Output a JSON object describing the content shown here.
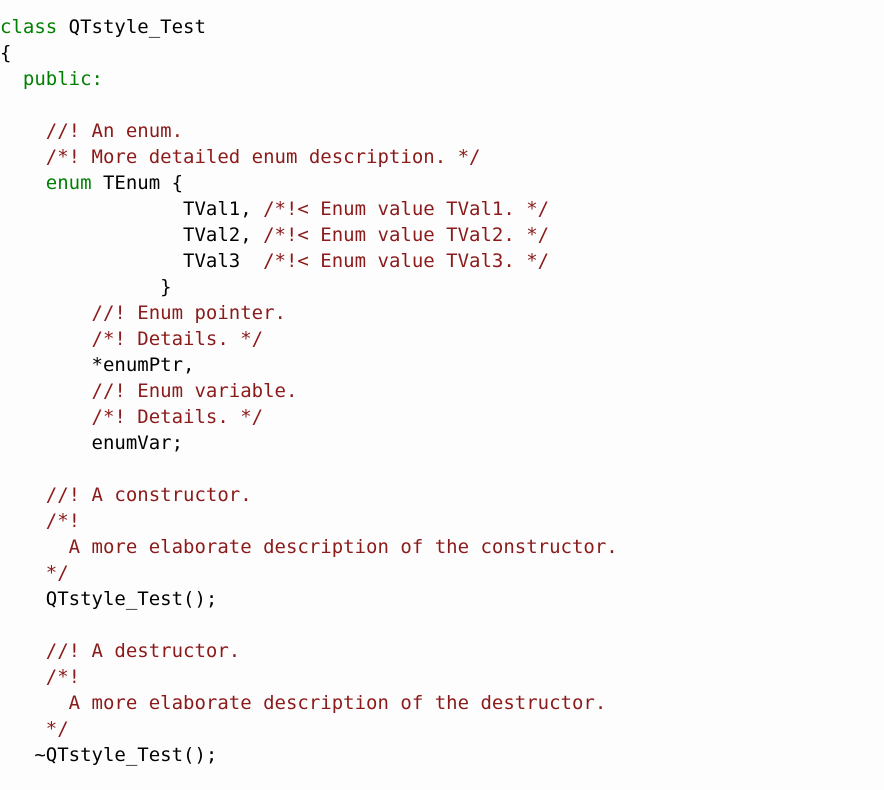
{
  "document": {
    "kind": "source-code-listing",
    "language": "C++",
    "class_name": "QTstyle_Test"
  },
  "colors": {
    "background": "#fdfdfd",
    "keyword": "#008000",
    "comment": "#8b1a1a",
    "identifier": "#000000"
  },
  "code": {
    "lines": [
      {
        "tokens": [
          {
            "t": "class ",
            "c": "kw"
          },
          {
            "t": "QTstyle_Test",
            "c": "plain"
          }
        ]
      },
      {
        "tokens": [
          {
            "t": "{",
            "c": "plain"
          }
        ]
      },
      {
        "tokens": [
          {
            "t": "  ",
            "c": "plain"
          },
          {
            "t": "public:",
            "c": "kw"
          }
        ]
      },
      {
        "tokens": []
      },
      {
        "tokens": [
          {
            "t": "    ",
            "c": "plain"
          },
          {
            "t": "//! An enum.",
            "c": "comment"
          }
        ]
      },
      {
        "tokens": [
          {
            "t": "    ",
            "c": "plain"
          },
          {
            "t": "/*! More detailed enum description. */",
            "c": "comment"
          }
        ]
      },
      {
        "tokens": [
          {
            "t": "    ",
            "c": "plain"
          },
          {
            "t": "enum ",
            "c": "kw"
          },
          {
            "t": "TEnum {",
            "c": "plain"
          }
        ]
      },
      {
        "tokens": [
          {
            "t": "                TVal1, ",
            "c": "plain"
          },
          {
            "t": "/*!< Enum value TVal1. */",
            "c": "comment"
          }
        ]
      },
      {
        "tokens": [
          {
            "t": "                TVal2, ",
            "c": "plain"
          },
          {
            "t": "/*!< Enum value TVal2. */",
            "c": "comment"
          }
        ]
      },
      {
        "tokens": [
          {
            "t": "                TVal3  ",
            "c": "plain"
          },
          {
            "t": "/*!< Enum value TVal3. */",
            "c": "comment"
          }
        ]
      },
      {
        "tokens": [
          {
            "t": "              }",
            "c": "plain"
          }
        ]
      },
      {
        "tokens": [
          {
            "t": "        ",
            "c": "plain"
          },
          {
            "t": "//! Enum pointer.",
            "c": "comment"
          }
        ]
      },
      {
        "tokens": [
          {
            "t": "        ",
            "c": "plain"
          },
          {
            "t": "/*! Details. */",
            "c": "comment"
          }
        ]
      },
      {
        "tokens": [
          {
            "t": "        *enumPtr,",
            "c": "plain"
          }
        ]
      },
      {
        "tokens": [
          {
            "t": "        ",
            "c": "plain"
          },
          {
            "t": "//! Enum variable.",
            "c": "comment"
          }
        ]
      },
      {
        "tokens": [
          {
            "t": "        ",
            "c": "plain"
          },
          {
            "t": "/*! Details. */",
            "c": "comment"
          }
        ]
      },
      {
        "tokens": [
          {
            "t": "        enumVar;",
            "c": "plain"
          }
        ]
      },
      {
        "tokens": []
      },
      {
        "tokens": [
          {
            "t": "    ",
            "c": "plain"
          },
          {
            "t": "//! A constructor.",
            "c": "comment"
          }
        ]
      },
      {
        "tokens": [
          {
            "t": "    ",
            "c": "plain"
          },
          {
            "t": "/*!",
            "c": "comment"
          }
        ]
      },
      {
        "tokens": [
          {
            "t": "    ",
            "c": "plain"
          },
          {
            "t": "  A more elaborate description of the constructor.",
            "c": "comment"
          }
        ]
      },
      {
        "tokens": [
          {
            "t": "    ",
            "c": "plain"
          },
          {
            "t": "*/",
            "c": "comment"
          }
        ]
      },
      {
        "tokens": [
          {
            "t": "    QTstyle_Test();",
            "c": "plain"
          }
        ]
      },
      {
        "tokens": []
      },
      {
        "tokens": [
          {
            "t": "    ",
            "c": "plain"
          },
          {
            "t": "//! A destructor.",
            "c": "comment"
          }
        ]
      },
      {
        "tokens": [
          {
            "t": "    ",
            "c": "plain"
          },
          {
            "t": "/*!",
            "c": "comment"
          }
        ]
      },
      {
        "tokens": [
          {
            "t": "    ",
            "c": "plain"
          },
          {
            "t": "  A more elaborate description of the destructor.",
            "c": "comment"
          }
        ]
      },
      {
        "tokens": [
          {
            "t": "    ",
            "c": "plain"
          },
          {
            "t": "*/",
            "c": "comment"
          }
        ]
      },
      {
        "tokens": [
          {
            "t": "   ~QTstyle_Test();",
            "c": "plain"
          }
        ]
      }
    ]
  }
}
